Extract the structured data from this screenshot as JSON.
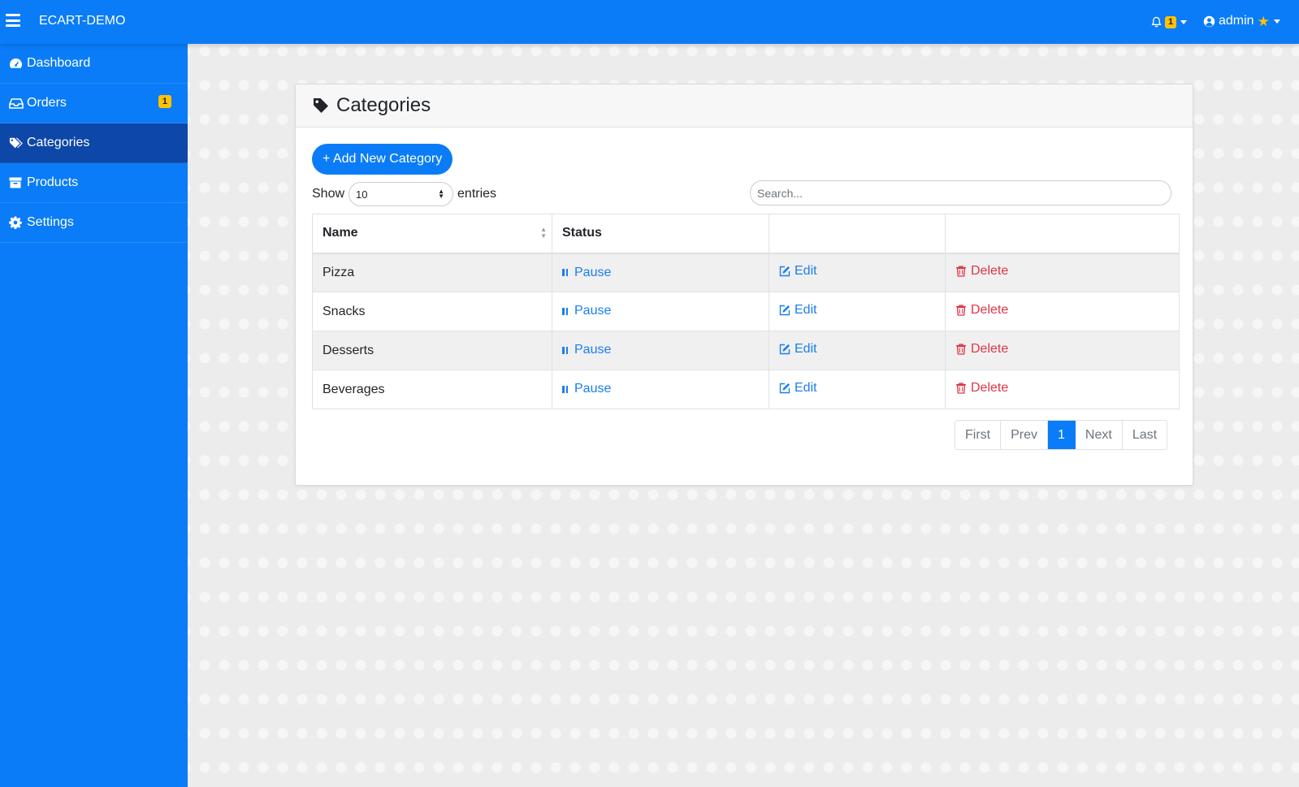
{
  "app": {
    "brand": "ECART-DEMO"
  },
  "topbar": {
    "notification_count": "1",
    "user_name": "admin"
  },
  "sidebar": {
    "items": [
      {
        "label": "Dashboard",
        "icon": "tachometer-icon"
      },
      {
        "label": "Orders",
        "icon": "inbox-icon",
        "badge": "1"
      },
      {
        "label": "Categories",
        "icon": "tags-icon",
        "active": true
      },
      {
        "label": "Products",
        "icon": "archive-icon"
      },
      {
        "label": "Settings",
        "icon": "gear-icon"
      }
    ]
  },
  "page": {
    "title": "Categories",
    "add_button": "+ Add New Category",
    "show_label": "Show",
    "entries_label": "entries",
    "page_length": "10",
    "search_placeholder": "Search..."
  },
  "table": {
    "headers": [
      "Name",
      "Status",
      "",
      ""
    ],
    "rows": [
      {
        "name": "Pizza",
        "status_action": "Pause",
        "edit": "Edit",
        "delete": "Delete"
      },
      {
        "name": "Snacks",
        "status_action": "Pause",
        "edit": "Edit",
        "delete": "Delete"
      },
      {
        "name": "Desserts",
        "status_action": "Pause",
        "edit": "Edit",
        "delete": "Delete"
      },
      {
        "name": "Beverages",
        "status_action": "Pause",
        "edit": "Edit",
        "delete": "Delete"
      }
    ]
  },
  "pagination": {
    "first": "First",
    "prev": "Prev",
    "current": "1",
    "next": "Next",
    "last": "Last"
  },
  "colors": {
    "primary": "#0a7cf8",
    "sidebar_active": "#0d47a8",
    "badge": "#ffc107",
    "danger": "#dc3545"
  }
}
